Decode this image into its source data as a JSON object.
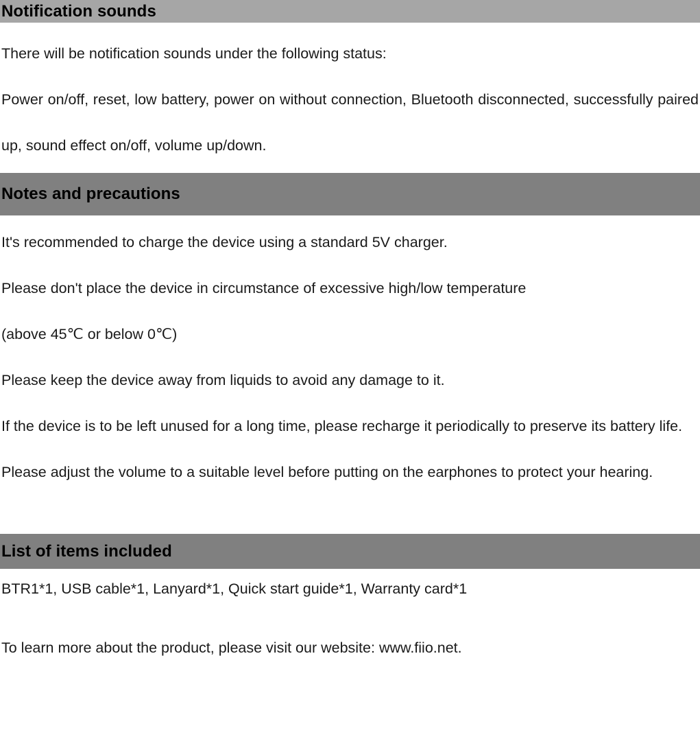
{
  "document": {
    "sections": [
      {
        "heading": "Notification sounds",
        "paragraphs": [
          "There will be notification sounds under the following status:",
          "Power on/off, reset, low battery, power on without connection, Bluetooth disconnected, successfully paired up, sound effect on/off, volume up/down."
        ]
      },
      {
        "heading": "Notes and precautions",
        "paragraphs": [
          "It's recommended to charge the device using a standard 5V charger.",
          "Please don't place the device in circumstance of excessive high/low temperature",
          "(above 45℃  or below 0℃)",
          "Please keep the device away from liquids to avoid any damage to it.",
          "If the device is to be left unused for a long time, please recharge it periodically to preserve its battery life.",
          "Please adjust the volume to a suitable level before putting on the earphones to protect your hearing."
        ]
      },
      {
        "heading": "List of items included",
        "paragraphs": [
          "BTR1*1, USB cable*1, Lanyard*1, Quick start guide*1, Warranty card*1",
          "To learn more about the product, please visit our website: www.fiio.net."
        ]
      }
    ]
  },
  "colors": {
    "band_light": "#a6a6a6",
    "band_dark": "#808080",
    "text": "#000000",
    "page_background": "#ffffff"
  }
}
